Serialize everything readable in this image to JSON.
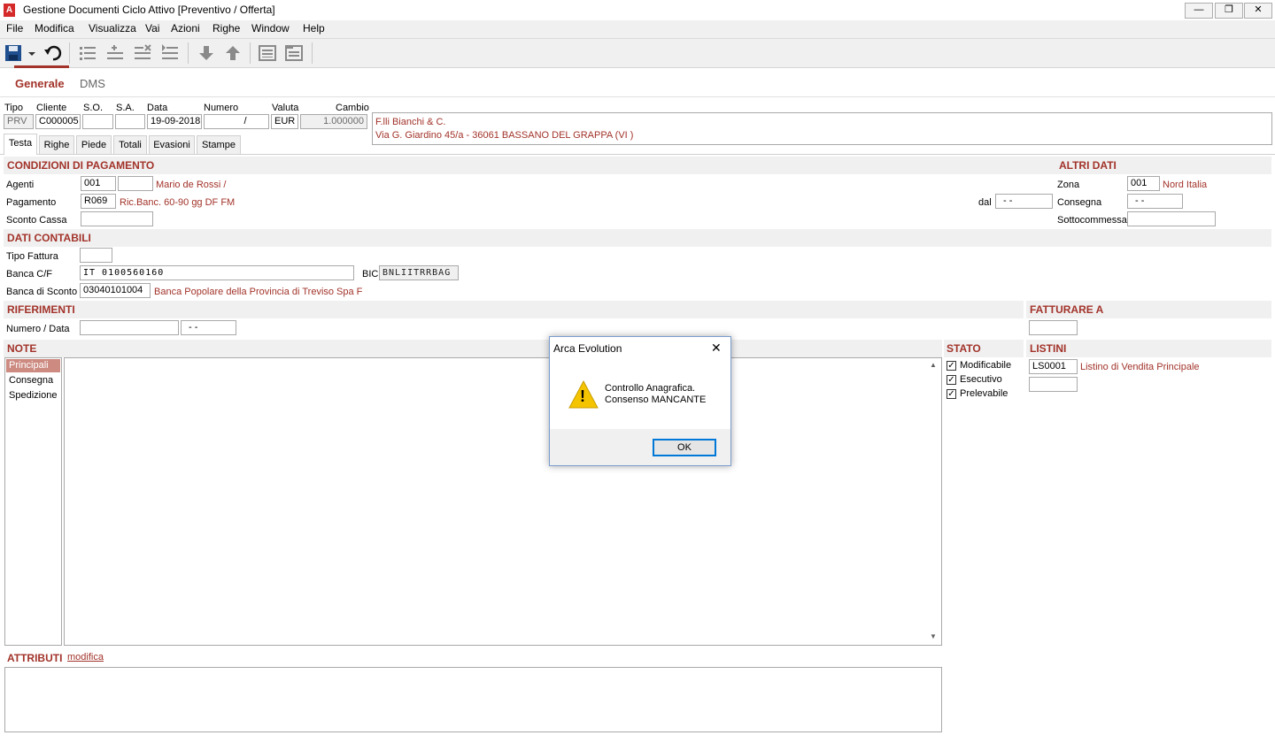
{
  "window": {
    "title": "Gestione Documenti Ciclo Attivo [Preventivo / Offerta]",
    "app_icon_letter": "A",
    "minimize": "—",
    "restore": "❐",
    "close": "✕"
  },
  "menu": [
    "File",
    "Modifica",
    "Visualizza",
    "Vai",
    "Azioni",
    "Righe",
    "Window",
    "Help"
  ],
  "toolbar": {
    "icons": [
      "save-icon",
      "dropdown-arrow-icon",
      "undo-icon",
      "list-icon",
      "add-row-icon",
      "delete-row-icon",
      "insert-row-icon",
      "arrow-down-icon",
      "arrow-up-icon",
      "document-icon",
      "document-list-icon"
    ]
  },
  "top_tabs": [
    "Generale",
    "DMS"
  ],
  "header": {
    "labels": {
      "tipo": "Tipo",
      "cliente": "Cliente",
      "so": "S.O.",
      "sa": "S.A.",
      "data": "Data",
      "numero": "Numero",
      "valuta": "Valuta",
      "cambio": "Cambio"
    },
    "values": {
      "tipo": "PRV",
      "cliente": "C000005",
      "so": "",
      "sa": "",
      "data": "19-09-2018",
      "numero": "/",
      "valuta": "EUR",
      "cambio": "1.000000"
    },
    "address_line1": "F.lli Bianchi & C.",
    "address_line2": "Via G. Giardino 45/a - 36061 BASSANO DEL GRAPPA (VI )"
  },
  "sub_tabs": [
    "Testa",
    "Righe",
    "Piede",
    "Totali",
    "Evasioni",
    "Stampe"
  ],
  "condizioni": {
    "title": "CONDIZIONI DI PAGAMENTO",
    "agenti_label": "Agenti",
    "agenti_code": "001",
    "agenti_code2": "",
    "agenti_desc": "Mario de Rossi /",
    "pagamento_label": "Pagamento",
    "pagamento_code": "R069",
    "pagamento_desc": "Ric.Banc. 60-90 gg DF FM",
    "sconto_label": "Sconto Cassa",
    "sconto_value": "",
    "dal_label": "dal",
    "dal_value": "- -"
  },
  "altri": {
    "title": "ALTRI DATI",
    "zona_label": "Zona",
    "zona_code": "001",
    "zona_desc": "Nord Italia",
    "consegna_label": "Consegna",
    "consegna_value": "- -",
    "sottocommessa_label": "Sottocommessa",
    "sottocommessa_value": ""
  },
  "contabili": {
    "title": "DATI CONTABILI",
    "tipo_fattura_label": "Tipo Fattura",
    "tipo_fattura_value": "",
    "banca_cf_label": "Banca C/F",
    "banca_cf_value": "IT   0100560160",
    "bic_label": "BIC",
    "bic_value": "BNLIITRRBAG",
    "banca_sconto_label": "Banca di Sconto",
    "banca_sconto_code": "03040101004",
    "banca_sconto_desc": "Banca Popolare della Provincia di Treviso Spa F"
  },
  "riferimenti": {
    "title": "RIFERIMENTI",
    "numero_data_label": "Numero / Data",
    "numero_value": "",
    "data_value": "- -"
  },
  "fatturare": {
    "title": "FATTURARE A",
    "value": ""
  },
  "note": {
    "title": "NOTE",
    "items": [
      "Principali",
      "Consegna",
      "Spedizione"
    ],
    "scroll_up": "▲",
    "scroll_down": "▼"
  },
  "stato": {
    "title": "STATO",
    "items": [
      {
        "label": "Modificabile",
        "checked": true
      },
      {
        "label": "Esecutivo",
        "checked": true
      },
      {
        "label": "Prelevabile",
        "checked": true
      }
    ],
    "check_mark": "✓"
  },
  "listini": {
    "title": "LISTINI",
    "code": "LS0001",
    "desc": "Listino di Vendita Principale",
    "code2": ""
  },
  "attributi": {
    "title": "ATTRIBUTI",
    "link": "modifica"
  },
  "dialog": {
    "title": "Arca Evolution",
    "close": "✕",
    "warning_glyph": "!",
    "line1": "Controllo Anagrafica.",
    "line2": "Consenso MANCANTE",
    "ok": "OK"
  },
  "colors": {
    "accent_red": "#a2332a",
    "title_red": "#d42a2a",
    "warning_yellow": "#f5c400"
  }
}
